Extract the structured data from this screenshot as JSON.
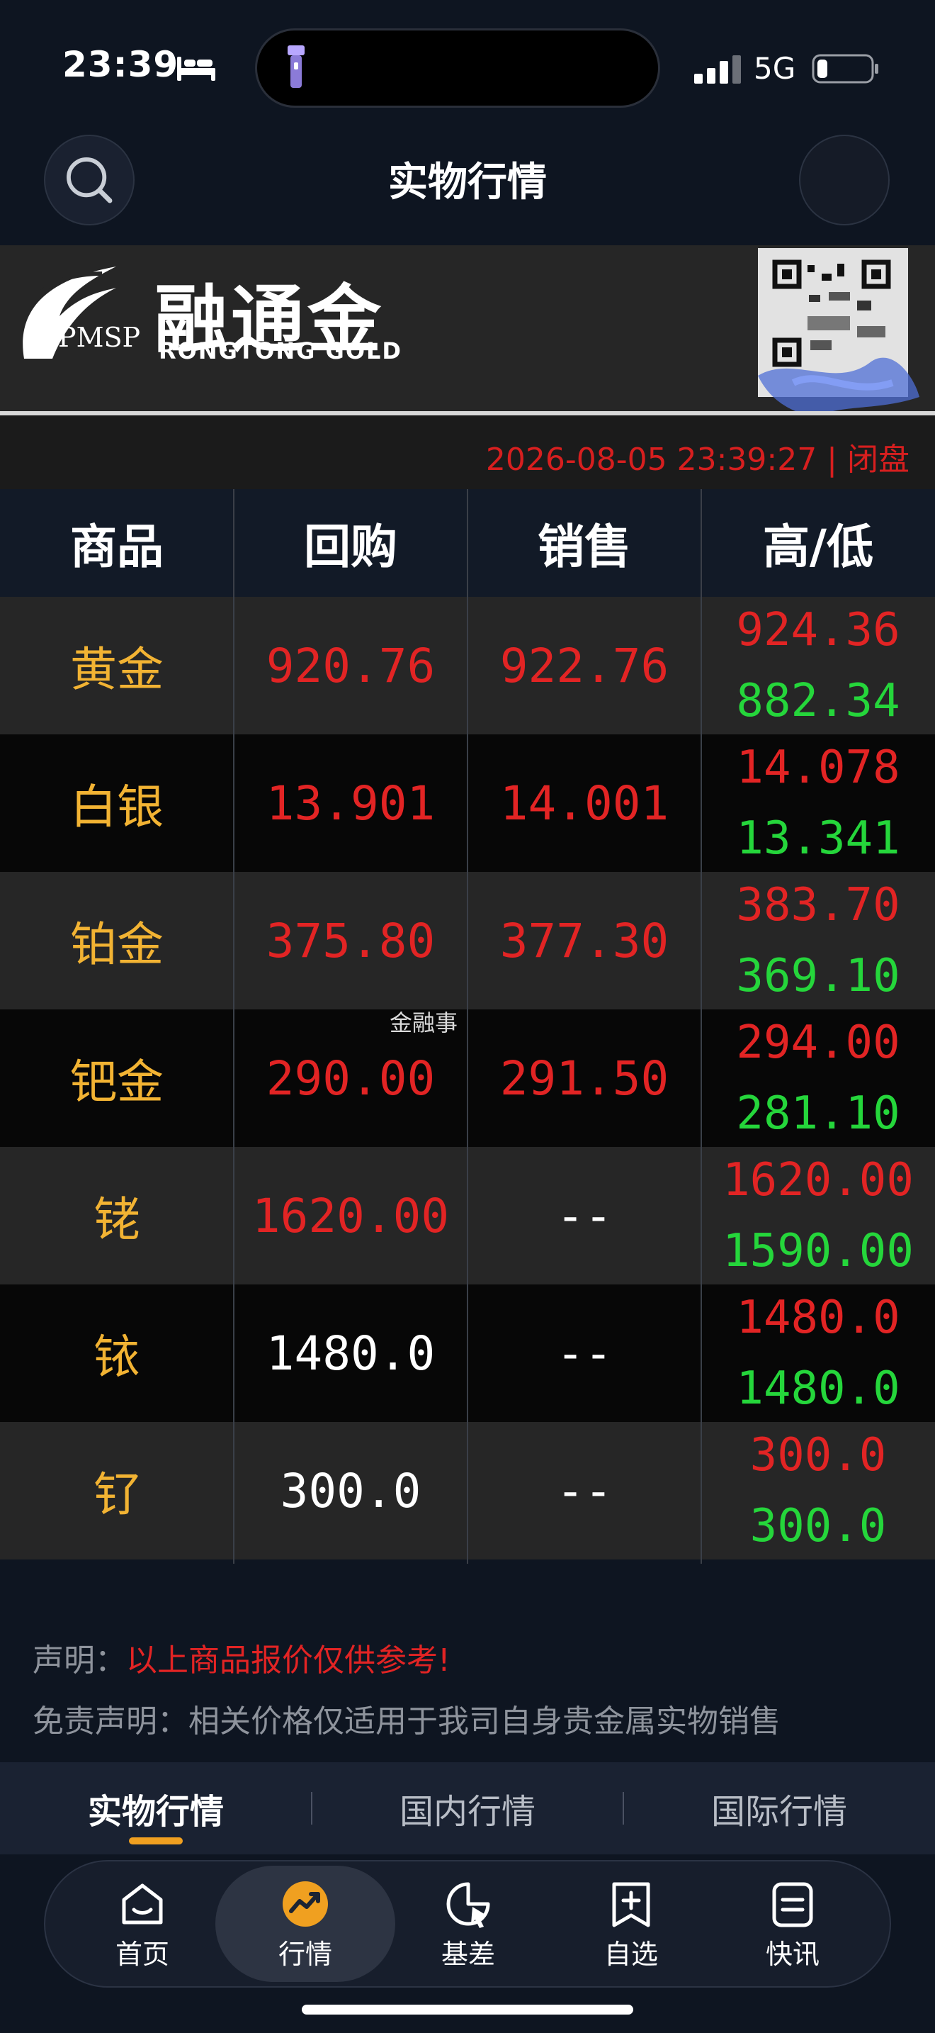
{
  "status_bar": {
    "time": "23:39",
    "network": "5G",
    "battery_level": 0.2
  },
  "header": {
    "title": "实物行情"
  },
  "banner": {
    "brand_cn": "融通金",
    "brand_en": "RONGTONG GOLD",
    "brand_abbr": "PMSP"
  },
  "market": {
    "timestamp": "2026-08-05 23:39:27 | 闭盘"
  },
  "table": {
    "headers": [
      "商品",
      "回购",
      "销售",
      "高/低"
    ],
    "rows": [
      {
        "name": "黄金",
        "buyback": "920.76",
        "sell": "922.76",
        "high": "924.36",
        "low": "882.34"
      },
      {
        "name": "白银",
        "buyback": "13.901",
        "sell": "14.001",
        "high": "14.078",
        "low": "13.341"
      },
      {
        "name": "铂金",
        "buyback": "375.80",
        "sell": "377.30",
        "high": "383.70",
        "low": "369.10"
      },
      {
        "name": "钯金",
        "buyback": "290.00",
        "sell": "291.50",
        "high": "294.00",
        "low": "281.10"
      },
      {
        "name": "铑",
        "buyback": "1620.00",
        "sell": "--",
        "high": "1620.00",
        "low": "1590.00"
      },
      {
        "name": "铱",
        "buyback": "1480.0",
        "sell": "--",
        "high": "1480.0",
        "low": "1480.0"
      },
      {
        "name": "钌",
        "buyback": "300.0",
        "sell": "--",
        "high": "300.0",
        "low": "300.0"
      }
    ]
  },
  "watermark": "金融事",
  "disclaimer": {
    "notice_label": "声明：",
    "notice_text": "以上商品报价仅供参考!",
    "disclaimer_text": "免责声明：相关价格仅适用于我司自身贵金属实物销售"
  },
  "sub_tabs": [
    "实物行情",
    "国内行情",
    "国际行情"
  ],
  "bottom_nav": [
    {
      "label": "首页",
      "icon": "home-icon"
    },
    {
      "label": "行情",
      "icon": "chart-trend-icon"
    },
    {
      "label": "基差",
      "icon": "pie-cursor-icon"
    },
    {
      "label": "自选",
      "icon": "add-bookmark-icon"
    },
    {
      "label": "快讯",
      "icon": "news-icon"
    }
  ],
  "colors": {
    "price_up": "#e22424",
    "price_down": "#25d63b",
    "commodity": "#f2b333",
    "accent": "#f0a020"
  }
}
